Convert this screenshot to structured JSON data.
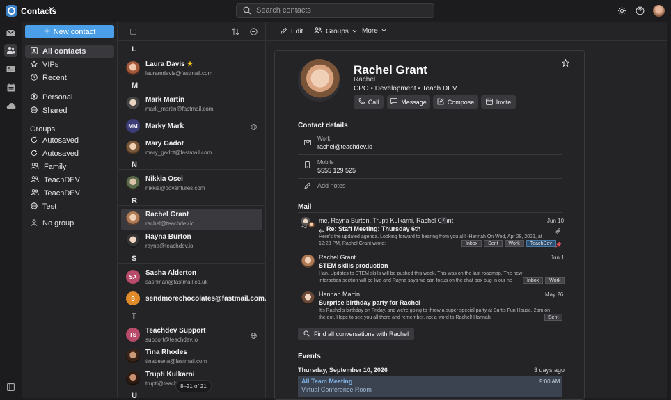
{
  "app": {
    "title": "Contacts"
  },
  "search": {
    "placeholder": "Search contacts"
  },
  "sidebar": {
    "new_contact_label": "New contact",
    "items": [
      {
        "label": "All contacts",
        "icon": "all-contacts-icon"
      },
      {
        "label": "VIPs",
        "icon": "star-icon"
      },
      {
        "label": "Recent",
        "icon": "clock-icon"
      },
      {
        "label": "Personal",
        "icon": "person-circle-icon"
      },
      {
        "label": "Shared",
        "icon": "globe-icon"
      }
    ],
    "groups_heading": "Groups",
    "groups": [
      {
        "label": "Autosaved",
        "icon": "autosave-icon"
      },
      {
        "label": "Autosaved",
        "icon": "autosave-icon"
      },
      {
        "label": "Family",
        "icon": "people-icon"
      },
      {
        "label": "TeachDEV",
        "icon": "people-icon"
      },
      {
        "label": "TeachDEV",
        "icon": "people-icon"
      },
      {
        "label": "Test",
        "icon": "globe-icon"
      },
      {
        "label": "No group",
        "icon": "person-icon"
      }
    ]
  },
  "contact_list": {
    "letters": [
      "L",
      "M",
      "N",
      "R",
      "S",
      "T",
      "U"
    ],
    "contacts": [
      {
        "name": "Laura Davis",
        "email": "lauramdavis@fastmail.com",
        "star": "★"
      },
      {
        "name": "Mark Martin",
        "email": "mark_martin@fastmail.com"
      },
      {
        "name": "Marky Mark",
        "initials": "MM"
      },
      {
        "name": "Mary Gadot",
        "email": "mary_gadot@fastmail.com"
      },
      {
        "name": "Nikkia Osei",
        "email": "nikkia@doventures.com"
      },
      {
        "name": "Rachel Grant",
        "email": "rachel@teachdev.io"
      },
      {
        "name": "Rayna Burton",
        "email": "rayna@teachdev.io"
      },
      {
        "name": "Sasha Alderton",
        "email": "sashman@fastmail.co.uk",
        "initials": "SA"
      },
      {
        "name": "sendmorechocolates@fastmail.com.au",
        "initials": "S"
      },
      {
        "name": "Teachdev Support",
        "email": "support@teachdev.io",
        "initials": "TS"
      },
      {
        "name": "Tina Rhodes",
        "email": "tinabeena@fastmail.com"
      },
      {
        "name": "Trupti Kulkarni",
        "email": "trupti@teachdev.io"
      }
    ],
    "page_counter": "8–21 of 21"
  },
  "toolbar": {
    "edit": "Edit",
    "groups": "Groups",
    "more": "More"
  },
  "profile": {
    "name": "Rachel Grant",
    "first_name": "Rachel",
    "title_line": "CPO • Development • Teach DEV",
    "actions": [
      "Call",
      "Message",
      "Compose",
      "Invite"
    ]
  },
  "contact_details": {
    "heading": "Contact details",
    "work_label": "Work",
    "work_value": "rachel@teachdev.io",
    "mobile_label": "Mobile",
    "mobile_value": "5555 129 525",
    "notes_placeholder": "Add notes"
  },
  "mail": {
    "heading": "Mail",
    "threads": [
      {
        "from": "me, Rayna Burton, Trupti Kulkarni, Rachel Grant",
        "count": "7",
        "subject": "Re: Staff Meeting: Thursday 6th",
        "snippet": "Here's the updated agenda. Looking forward to hearing from you all! -Hannah On Wed, Apr 28, 2021, at 12:23 PM, Rachel Grant wrote:",
        "date": "Jun 10",
        "tags": [
          "Inbox",
          "Sent",
          "Work",
          "TeachDev"
        ],
        "avatar_count": "+2"
      },
      {
        "from": "Rachel Grant",
        "subject": "STEM skills production",
        "snippet": "Han, Updates to STEM skills will be pushed this week. This was on the last roadmap. The new interaction section will be live and Rayna says we can focus on the chat box bug in our ne",
        "date": "Jun 1",
        "tags": [
          "Inbox",
          "Work"
        ]
      },
      {
        "from": "Hannah Martin",
        "subject": "Surprise birthday party for Rachel",
        "snippet": "It's Rachel's birthday on Friday, and we're going to throw a super special party at Burt's Fun House, 2pm on the dot. Hope to see you all there and remember, not a word to Rachel! Hannah",
        "date": "May 26",
        "tags": [
          "Sent"
        ]
      }
    ],
    "find_all": "Find all conversations with Rachel"
  },
  "events": {
    "heading": "Events",
    "date": "Thursday, September 10, 2026",
    "relative": "3 days ago",
    "event_title": "All Team Meeting",
    "event_time": "9:00 AM",
    "event_location": "Virtual Conference Room"
  },
  "colors": {
    "accent": "#4a9fe8",
    "background": "#1c1c1e",
    "panel": "#242427",
    "selected": "#3a3a3e",
    "star": "#f5c518",
    "pin": "#e0505a"
  }
}
